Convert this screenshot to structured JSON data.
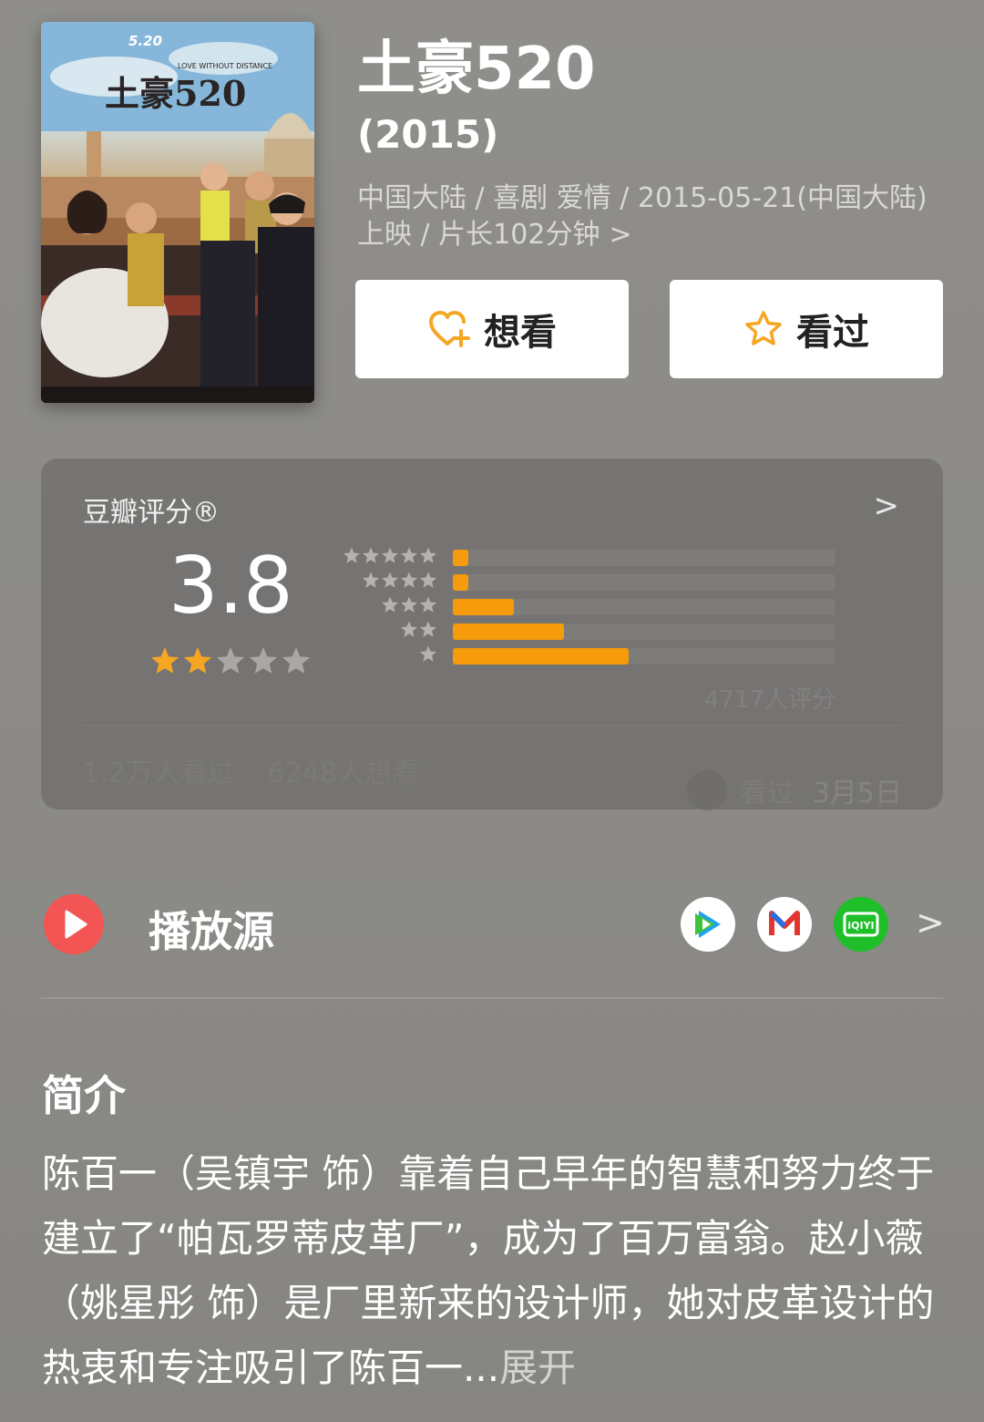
{
  "movie": {
    "title": "土豪520",
    "year": "(2015)",
    "meta": "中国大陆 / 喜剧 爱情 / 2015-05-21(中国大陆)上映 / 片长102分钟",
    "meta_chevron": ">",
    "poster": {
      "top_text": "5.20",
      "title_text": "土豪520",
      "subtitle_text": "LOVE WITHOUT DISTANCE"
    }
  },
  "actions": {
    "want_label": "想看",
    "seen_label": "看过",
    "accent_color": "#f5a623"
  },
  "rating": {
    "label": "豆瓣评分®",
    "chevron": ">",
    "score": "3.8",
    "score_stars": 2,
    "distribution": [
      {
        "stars": 5,
        "fraction": 0.04
      },
      {
        "stars": 4,
        "fraction": 0.04
      },
      {
        "stars": 3,
        "fraction": 0.16
      },
      {
        "stars": 2,
        "fraction": 0.29
      },
      {
        "stars": 1,
        "fraction": 0.46
      }
    ],
    "count_text": "4717人评分",
    "watched_text": "1.2万人看过",
    "want_text": "6248人想看",
    "my_status": "看过",
    "my_date": "3月5日",
    "bar_color": "#f59b0c"
  },
  "play": {
    "label": "播放源",
    "sources": [
      "tencent-video-icon",
      "mango-tv-icon",
      "iqiyi-icon"
    ],
    "iqiyi_text": "iQIYI",
    "chevron": ">"
  },
  "intro": {
    "title": "简介",
    "text": "陈百一（吴镇宇 饰）靠着自己早年的智慧和努力终于建立了“帕瓦罗蒂皮革厂”，成为了百万富翁。赵小薇（姚星彤 饰）是厂里新来的设计师，她对皮革设计的热衷和专注吸引了陈百一...",
    "expand": "展开"
  }
}
